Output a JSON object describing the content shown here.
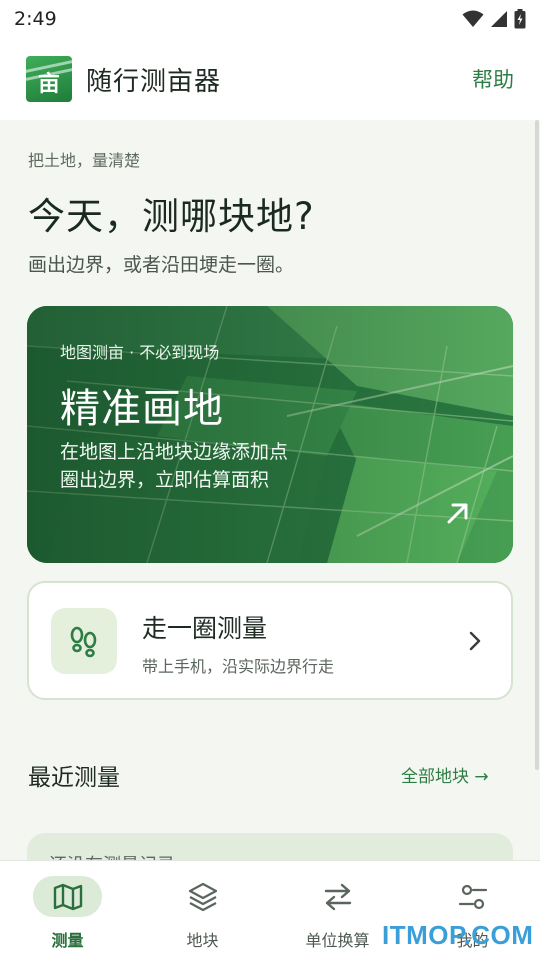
{
  "status_bar": {
    "time": "2:49"
  },
  "app_bar": {
    "title": "随行测亩器",
    "help": "帮助",
    "logo_glyph": "亩"
  },
  "intro": {
    "eyebrow": "把土地，量清楚",
    "headline": "今天，测哪块地?",
    "subline": "画出边界，或者沿田埂走一圈。"
  },
  "hero_card": {
    "eyebrow": "地图测亩 · 不必到现场",
    "title": "精准画地",
    "desc_line1": "在地图上沿地块边缘添加点",
    "desc_line2": "圈出边界，立即估算面积"
  },
  "walk_card": {
    "title": "走一圈测量",
    "subtitle": "带上手机，沿实际边界行走"
  },
  "recent": {
    "title": "最近测量",
    "link": "全部地块 →",
    "empty_text": "还没有测量记录"
  },
  "bottom_nav": {
    "items": [
      {
        "label": "测量",
        "icon": "map-icon",
        "active": true
      },
      {
        "label": "地块",
        "icon": "layers-icon",
        "active": false
      },
      {
        "label": "单位换算",
        "icon": "swap-arrows-icon",
        "active": false
      },
      {
        "label": "我的",
        "icon": "sliders-icon",
        "active": false
      }
    ]
  },
  "watermark": "ITMOP.COM",
  "colors": {
    "brand_green": "#2e7d45",
    "background": "#f3f6f1",
    "active_pill": "#dcebd7",
    "watermark": "#3a9fd9"
  }
}
